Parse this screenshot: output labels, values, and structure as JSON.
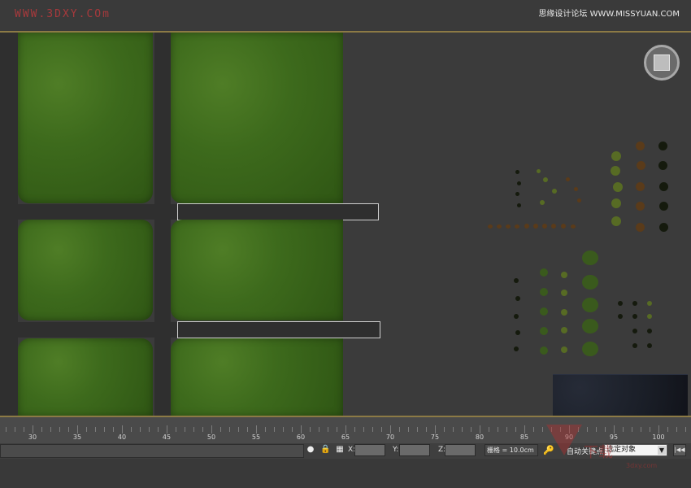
{
  "watermark": {
    "left": "WWW.3DXY.COm",
    "right": "思缘设计论坛 WWW.MISSYUAN.COM",
    "bottom_big": "下载",
    "bottom_small": "3dxy.com"
  },
  "timeline": {
    "labels": [
      "30",
      "35",
      "40",
      "45",
      "50",
      "55",
      "60",
      "65",
      "70",
      "75",
      "80",
      "85",
      "90",
      "95",
      "100"
    ]
  },
  "statusbar": {
    "x_label": "X:",
    "y_label": "Y:",
    "z_label": "Z:",
    "grid_text": "栅格 = 10.0cm",
    "autokey_label": "自动关键点",
    "selection_text": "选定对象",
    "goto_start_label": "|◀◀"
  }
}
